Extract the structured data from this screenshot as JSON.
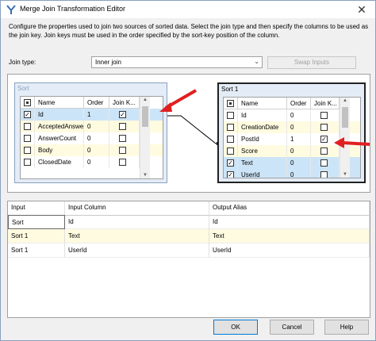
{
  "window": {
    "title": "Merge Join Transformation Editor",
    "close_glyph": "✕",
    "description": "Configure the properties used to join two sources of sorted data. Select the join type and then specify the columns to be used as the join key. Join keys must be used in the order specified by the sort-key position of the column."
  },
  "join": {
    "label": "Join type:",
    "value": "Inner join",
    "swap_label": "Swap Inputs"
  },
  "left_input": {
    "title": "Sort",
    "headers": [
      "Name",
      "Order",
      "Join K..."
    ],
    "rows": [
      {
        "name": "Id",
        "order": "1",
        "join": true,
        "selected": true
      },
      {
        "name": "AcceptedAnswerId",
        "order": "0",
        "join": false
      },
      {
        "name": "AnswerCount",
        "order": "0",
        "join": false
      },
      {
        "name": "Body",
        "order": "0",
        "join": false
      },
      {
        "name": "ClosedDate",
        "order": "0",
        "join": false
      }
    ]
  },
  "right_input": {
    "title": "Sort 1",
    "headers": [
      "Name",
      "Order",
      "Join K..."
    ],
    "rows": [
      {
        "name": "Id",
        "order": "0",
        "join": false
      },
      {
        "name": "CreationDate",
        "order": "0",
        "join": false
      },
      {
        "name": "PostId",
        "order": "1",
        "join": true
      },
      {
        "name": "Score",
        "order": "0",
        "join": false
      },
      {
        "name": "Text",
        "order": "0",
        "join": false,
        "selected": true
      },
      {
        "name": "UserId",
        "order": "0",
        "join": false,
        "selected": true
      }
    ]
  },
  "mapping": {
    "headers": [
      "Input",
      "Input Column",
      "Output Alias"
    ],
    "rows": [
      [
        "Sort",
        "Id",
        "Id"
      ],
      [
        "Sort 1",
        "Text",
        "Text"
      ],
      [
        "Sort 1",
        "UserId",
        "UserId"
      ]
    ]
  },
  "buttons": {
    "ok": "OK",
    "cancel": "Cancel",
    "help": "Help"
  },
  "colors": {
    "arrow": "#e02020",
    "selection": "#cce4f7",
    "highlight": "#fffbe0"
  }
}
